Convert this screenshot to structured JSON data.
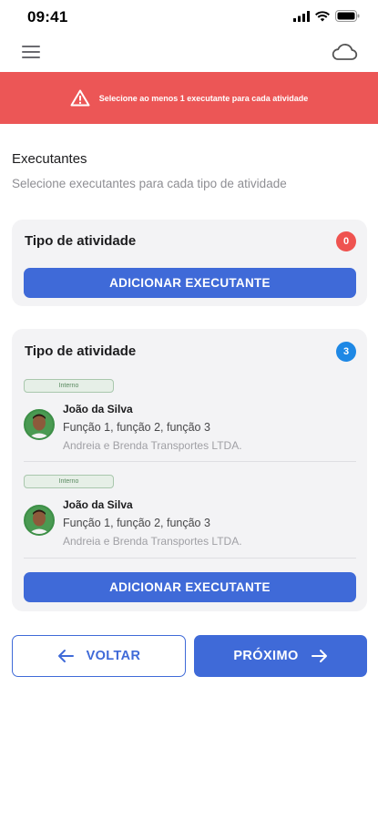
{
  "status_bar": {
    "time": "09:41"
  },
  "alert": {
    "message": "Selecione ao menos 1 executante para cada atividade"
  },
  "section": {
    "title": "Executantes",
    "subtitle": "Selecione executantes para cada tipo de atividade"
  },
  "cards": [
    {
      "title": "Tipo de atividade",
      "count": "0",
      "add_label": "ADICIONAR EXECUTANTE",
      "executants": []
    },
    {
      "title": "Tipo de atividade",
      "count": "3",
      "add_label": "ADICIONAR EXECUTANTE",
      "executants": [
        {
          "tag": "Interno",
          "name": "João da Silva",
          "functions": "Função 1, função 2, função 3",
          "company": "Andreia e Brenda Transportes LTDA."
        },
        {
          "tag": "Interno",
          "name": "João da Silva",
          "functions": "Função 1, função 2, função 3",
          "company": "Andreia e Brenda Transportes LTDA."
        }
      ]
    }
  ],
  "navigation": {
    "back_label": "VOLTAR",
    "next_label": "PRÓXIMO"
  },
  "colors": {
    "primary": "#3f6ad8",
    "alert": "#ec5656",
    "badge_red": "#ef5350",
    "badge_blue": "#1e88e5"
  },
  "icons": [
    "signal-icon",
    "wifi-icon",
    "battery-icon",
    "menu-icon",
    "cloud-icon",
    "warning-icon",
    "arrow-left-icon",
    "arrow-right-icon"
  ]
}
